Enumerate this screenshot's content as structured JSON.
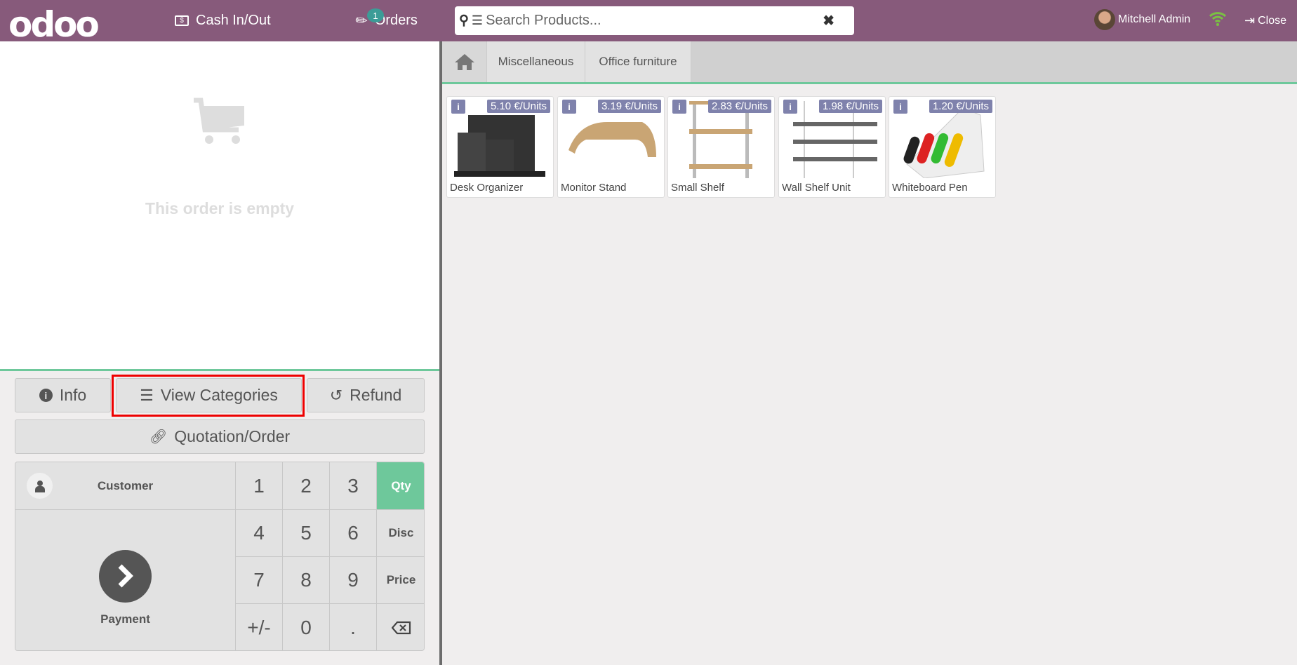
{
  "header": {
    "logo": "odoo",
    "cash_label": "Cash In/Out",
    "orders_label": "Orders",
    "orders_count": "1",
    "search_placeholder": "Search Products...",
    "user_name": "Mitchell Admin",
    "close_label": "Close",
    "color": "#875a7b"
  },
  "order": {
    "empty_text": "This order is empty"
  },
  "actions": {
    "info": "Info",
    "view_categories": "View Categories",
    "refund": "Refund",
    "quotation": "Quotation/Order"
  },
  "pad": {
    "customer": "Customer",
    "payment": "Payment",
    "keys": [
      "1",
      "2",
      "3",
      "4",
      "5",
      "6",
      "7",
      "8",
      "9",
      "+/-",
      "0",
      "."
    ],
    "modes": [
      "Qty",
      "Disc",
      "Price"
    ],
    "active_mode": "Qty",
    "accent": "#6ec89b"
  },
  "categories": [
    "Miscellaneous",
    "Office furniture"
  ],
  "products": [
    {
      "name": "Desk Organizer",
      "price": "5.10 €/Units"
    },
    {
      "name": "Monitor Stand",
      "price": "3.19 €/Units"
    },
    {
      "name": "Small Shelf",
      "price": "2.83 €/Units"
    },
    {
      "name": "Wall Shelf Unit",
      "price": "1.98 €/Units"
    },
    {
      "name": "Whiteboard Pen",
      "price": "1.20 €/Units"
    }
  ]
}
